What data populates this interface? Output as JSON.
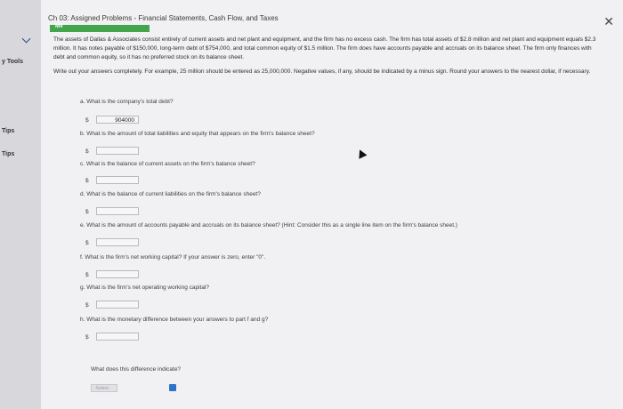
{
  "window": {
    "title": "Ch 03: Assigned Problems - Financial Statements, Cash Flow, and Taxes"
  },
  "left_rail": {
    "items": [
      "y Tools",
      "Tips",
      "Tips"
    ]
  },
  "tab": {
    "label": "M4"
  },
  "intro": "The assets of Dallas & Associates consist entirely of current assets and net plant and equipment, and the firm has no excess cash. The firm has total assets of $2.8 million and net plant and equipment equals $2.3 million. It has notes payable of $150,000, long-term debt of $754,000, and total common equity of $1.5 million. The firm does have accounts payable and accruals on its balance sheet. The firm only finances with debt and common equity, so it has no preferred stock on its balance sheet.",
  "instructions": "Write out your answers completely. For example, 25 million should be entered as 25,000,000. Negative values, if any, should be indicated by a minus sign. Round your answers to the nearest dollar, if necessary.",
  "questions": [
    {
      "label": "a. What is the company's total debt?",
      "answer": "904000"
    },
    {
      "label": "b. What is the amount of total liabilities and equity that appears on the firm's balance sheet?",
      "answer": ""
    },
    {
      "label": "c. What is the balance of current assets on the firm's balance sheet?",
      "answer": ""
    },
    {
      "label": "d. What is the balance of current liabilities on the firm's balance sheet?",
      "answer": ""
    },
    {
      "label": "e. What is the amount of accounts payable and accruals on its balance sheet? (Hint: Consider this as a single line item on the firm's balance sheet.)",
      "answer": ""
    },
    {
      "label": "f. What is the firm's net working capital? If your answer is zero, enter \"0\".",
      "answer": ""
    },
    {
      "label": "g. What is the firm's net operating working capital?",
      "answer": ""
    },
    {
      "label": "h. What is the monetary difference between your answers to part f and g?",
      "answer": ""
    }
  ],
  "currency_symbol": "$",
  "followup": "What does this difference indicate?",
  "select_placeholder": "-Select-",
  "icons": {
    "close": "close-icon",
    "chevron": "chevron-down-icon",
    "dropdown": "dropdown-icon"
  }
}
